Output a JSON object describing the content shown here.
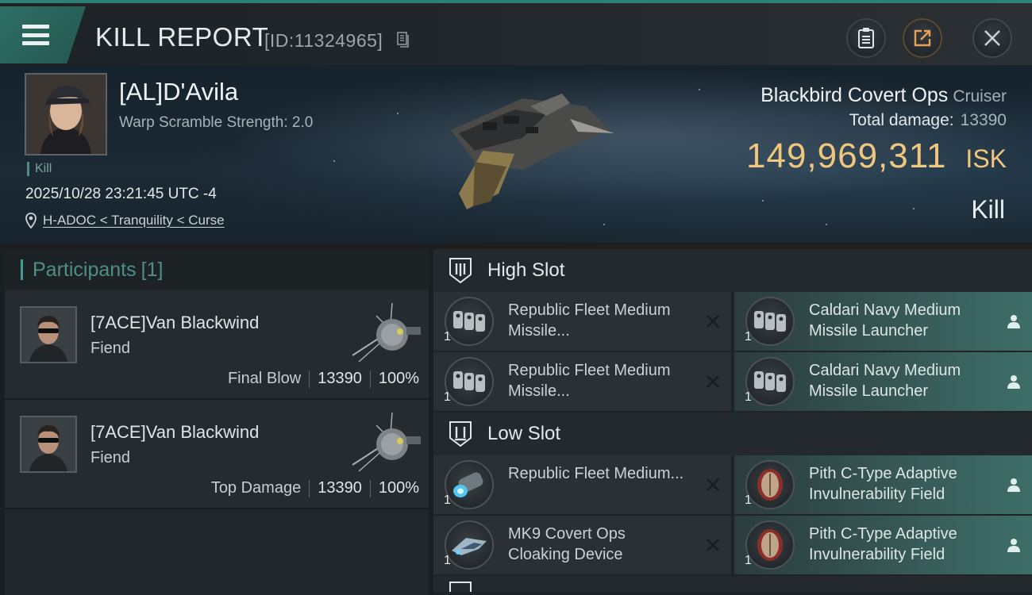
{
  "header": {
    "title": "KILL REPORT",
    "report_id": "[ID:11324965]"
  },
  "victim": {
    "name": "[AL]D'Avila",
    "warp_scramble": "Warp Scramble Strength: 2.0",
    "kill_tag": "Kill",
    "datetime": "2025/10/28 23:21:45 UTC -4",
    "location": "H-ADOC < Tranquility < Curse",
    "ship_name": "Blackbird Covert Ops",
    "ship_class": "Cruiser",
    "total_damage_label": "Total damage:",
    "total_damage_value": "13390",
    "isk_value": "149,969,311",
    "isk_unit": "ISK",
    "result": "Kill"
  },
  "participants": {
    "title": "Participants",
    "count": "[1]",
    "items": [
      {
        "name": "[7ACE]Van Blackwind",
        "ship": "Fiend",
        "role": "Final Blow",
        "damage": "13390",
        "percent": "100%"
      },
      {
        "name": "[7ACE]Van Blackwind",
        "ship": "Fiend",
        "role": "Top Damage",
        "damage": "13390",
        "percent": "100%"
      }
    ]
  },
  "fittings": {
    "high_slot": {
      "label": "High Slot",
      "rows": [
        {
          "left": {
            "name": "Republic Fleet Medium Missile...",
            "qty": "1",
            "icon": "missile-launcher-icon",
            "status": "destroyed"
          },
          "right": {
            "name": "Caldari Navy Medium Missile Launcher",
            "qty": "1",
            "icon": "missile-launcher-icon",
            "status": "dropped"
          }
        },
        {
          "left": {
            "name": "Republic Fleet Medium Missile...",
            "qty": "1",
            "icon": "missile-launcher-icon",
            "status": "destroyed"
          },
          "right": {
            "name": "Caldari Navy Medium Missile Launcher",
            "qty": "1",
            "icon": "missile-launcher-icon",
            "status": "dropped"
          }
        }
      ]
    },
    "low_slot": {
      "label": "Low Slot",
      "rows": [
        {
          "left": {
            "name": "Republic Fleet Medium...",
            "qty": "1",
            "icon": "capacitor-module-icon",
            "status": "destroyed"
          },
          "right": {
            "name": "Pith C-Type Adaptive Invulnerability Field",
            "qty": "1",
            "icon": "shield-module-icon",
            "status": "dropped"
          }
        },
        {
          "left": {
            "name": "MK9 Covert Ops Cloaking Device",
            "qty": "1",
            "icon": "cloaking-device-icon",
            "status": "destroyed"
          },
          "right": {
            "name": "Pith C-Type Adaptive Invulnerability Field",
            "qty": "1",
            "icon": "shield-module-icon",
            "status": "dropped"
          }
        }
      ]
    }
  },
  "colors": {
    "accent": "#3f9d8f",
    "isk": "#f0c77d",
    "dropped_bg": "#3e6e68"
  }
}
